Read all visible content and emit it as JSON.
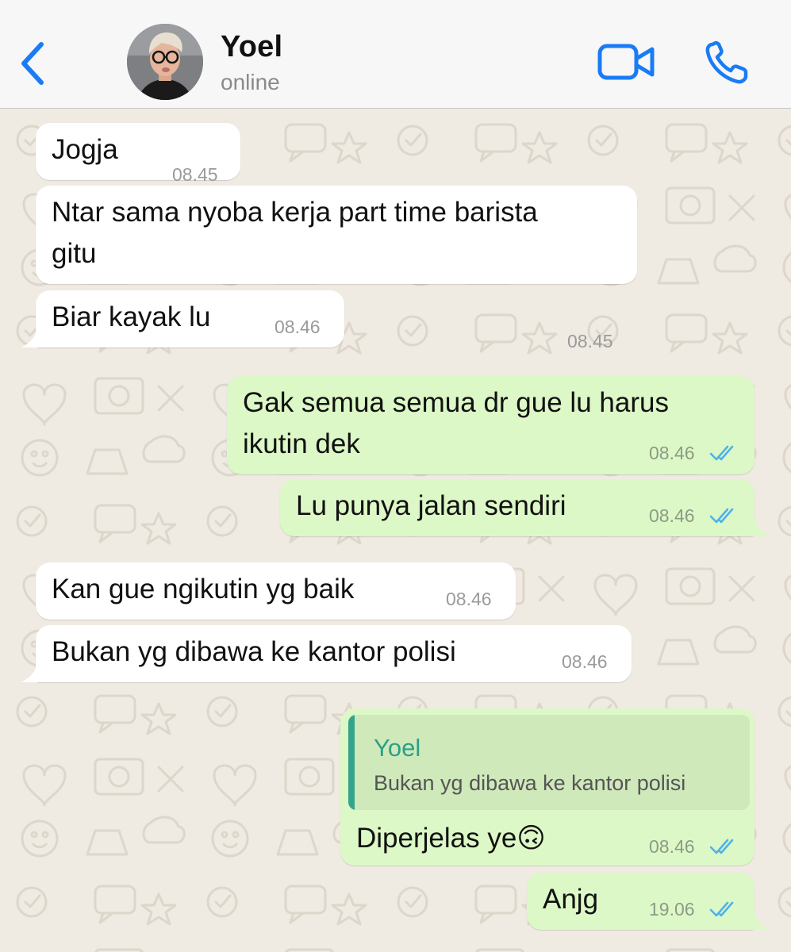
{
  "header": {
    "contact_name": "Yoel",
    "status": "online",
    "back_icon": "chevron-left-icon",
    "video_icon": "video-camera-icon",
    "call_icon": "phone-icon",
    "accent_color": "#1a7cf4"
  },
  "messages": [
    {
      "direction": "incoming",
      "text": "Jogja",
      "time": "08.45"
    },
    {
      "direction": "incoming",
      "text": "Ntar sama nyoba kerja part time barista\ngitu",
      "time": "08.45"
    },
    {
      "direction": "incoming",
      "text": "Biar kayak lu",
      "time": "08.46"
    },
    {
      "direction": "outgoing",
      "text": "Gak semua semua dr gue lu harus\nikutin dek",
      "time": "08.46",
      "status": "read"
    },
    {
      "direction": "outgoing",
      "text": "Lu punya jalan sendiri",
      "time": "08.46",
      "status": "read"
    },
    {
      "direction": "incoming",
      "text": "Kan gue ngikutin yg baik",
      "time": "08.46"
    },
    {
      "direction": "incoming",
      "text": "Bukan yg dibawa ke kantor polisi",
      "time": "08.46"
    },
    {
      "direction": "outgoing",
      "quote": {
        "author": "Yoel",
        "text": "Bukan yg dibawa ke kantor polisi"
      },
      "text": "Diperjelas ye🙃",
      "time": "08.46",
      "status": "read"
    },
    {
      "direction": "outgoing",
      "text": "Anjg",
      "time": "19.06",
      "status": "read"
    }
  ],
  "colors": {
    "incoming_bubble": "#ffffff",
    "outgoing_bubble": "#dcf8c6",
    "read_ticks": "#4fb2ea",
    "wallpaper": "#efeae2"
  }
}
